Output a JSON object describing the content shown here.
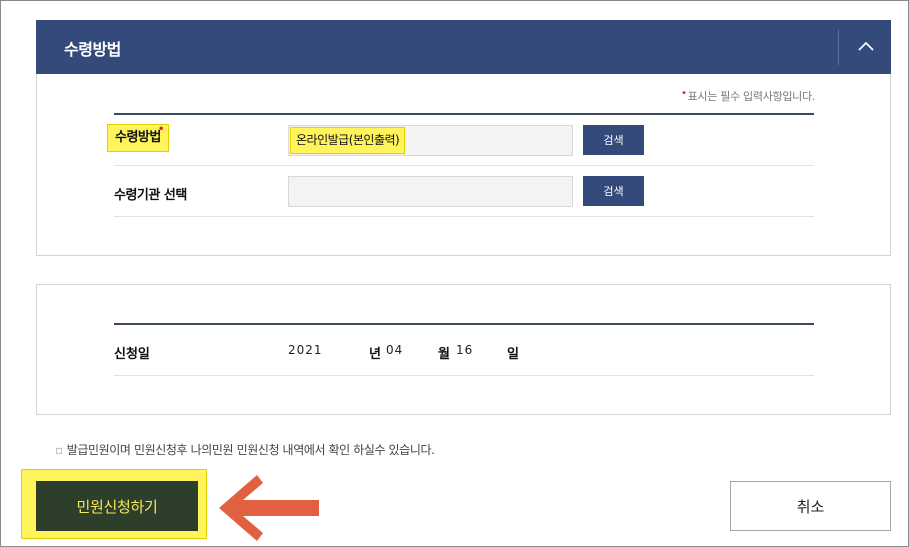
{
  "section": {
    "title": "수령방법",
    "collapse_icon": "chevron-up-icon"
  },
  "required_note": {
    "mark": "•",
    "text": "표시는 필수 입력사항입니다."
  },
  "fields": {
    "receive_method": {
      "label": "수령방법",
      "required_mark": "•",
      "value": "온라인발급(본인출력)",
      "button": "검색"
    },
    "receive_agency": {
      "label": "수령기관 선택",
      "value": "",
      "button": "검색"
    }
  },
  "application_date": {
    "label": "신청일",
    "year": "2021",
    "year_unit": "년",
    "month": "04",
    "month_unit": "월",
    "day": "16",
    "day_unit": "일"
  },
  "notice": {
    "bullet": "▫",
    "text": "발급민원이며 민원신청후 나의민원 민원신청 내역에서 확인 하실수 있습니다."
  },
  "actions": {
    "submit": "민원신청하기",
    "cancel": "취소"
  },
  "colors": {
    "header": "#334a7a",
    "highlight": "#fff45c",
    "submit_bg": "#2d3e2a",
    "arrow": "#e06040"
  }
}
